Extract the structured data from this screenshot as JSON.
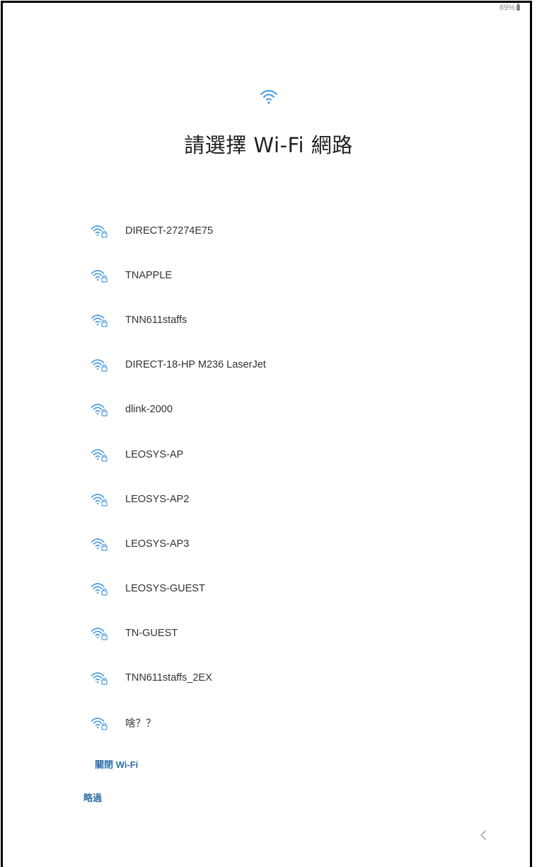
{
  "status_bar": {
    "battery_text": "69%",
    "battery_icon": "battery-icon"
  },
  "header": {
    "icon": "wifi-icon",
    "title": "請選擇 Wi-Fi 網路"
  },
  "networks": [
    {
      "name": "DIRECT-27274E75",
      "icon": "wifi-lock-icon"
    },
    {
      "name": "TNAPPLE",
      "icon": "wifi-lock-icon"
    },
    {
      "name": "TNN611staffs",
      "icon": "wifi-lock-icon"
    },
    {
      "name": "DIRECT-18-HP M236 LaserJet",
      "icon": "wifi-lock-icon"
    },
    {
      "name": "dlink-2000",
      "icon": "wifi-lock-icon"
    },
    {
      "name": "LEOSYS-AP",
      "icon": "wifi-lock-icon"
    },
    {
      "name": "LEOSYS-AP2",
      "icon": "wifi-lock-icon"
    },
    {
      "name": "LEOSYS-AP3",
      "icon": "wifi-lock-icon"
    },
    {
      "name": "LEOSYS-GUEST",
      "icon": "wifi-lock-icon"
    },
    {
      "name": "TN-GUEST",
      "icon": "wifi-lock-icon"
    },
    {
      "name": "TNN611staffs_2EX",
      "icon": "wifi-lock-icon"
    },
    {
      "name": "啥？？",
      "icon": "wifi-lock-icon"
    }
  ],
  "actions": {
    "turn_off_wifi": "關閉 Wi-Fi",
    "skip": "略過"
  },
  "nav": {
    "back_icon": "chevron-left-icon"
  },
  "colors": {
    "accent": "#2f6fa8",
    "wifi_icon": "#4a9be0",
    "text": "#333333"
  }
}
